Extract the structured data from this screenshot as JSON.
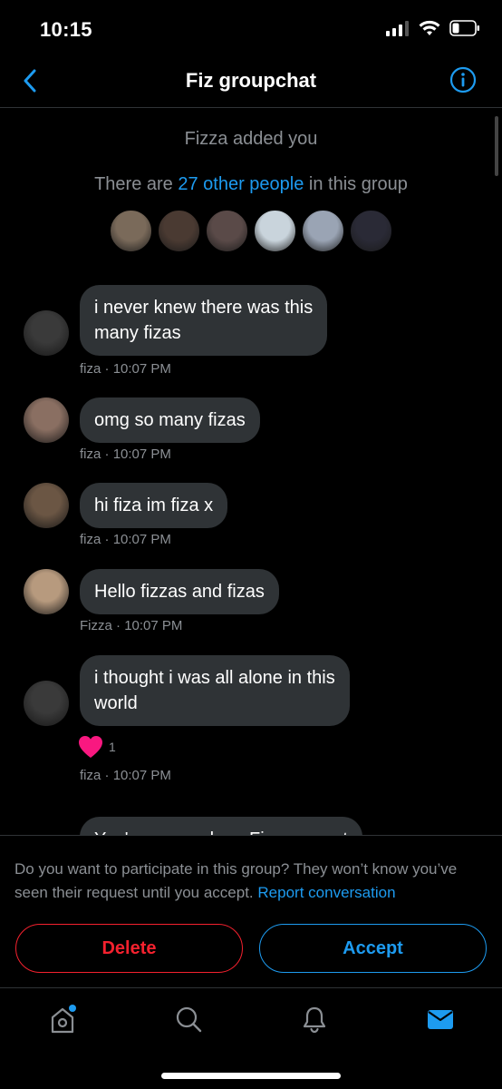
{
  "status_bar": {
    "time": "10:15"
  },
  "header": {
    "title": "Fiz groupchat"
  },
  "conversation": {
    "added_note": "Fizza added you",
    "others_prefix": "There are ",
    "others_link": "27 other people",
    "others_suffix": " in this group",
    "member_avatar_colors": [
      "#7a6a5a",
      "#4a3a32",
      "#5a4a48",
      "#c9d4dc",
      "#9aa4b4",
      "#2a2a36"
    ],
    "messages": [
      {
        "lines": [
          "i never knew there was this",
          "many fizas"
        ],
        "sender": "fiza",
        "time": "10:07 PM",
        "avatar_color": "#3a3a3a"
      },
      {
        "lines": [
          "omg so many fizas"
        ],
        "sender": "fiza",
        "time": "10:07 PM",
        "avatar_color": "#8a6f62"
      },
      {
        "lines": [
          "hi fiza im fiza x"
        ],
        "sender": "fiza",
        "time": "10:07 PM",
        "avatar_color": "#6b5644"
      },
      {
        "lines": [
          "Hello fizzas and fizas"
        ],
        "sender": "Fizza",
        "time": "10:07 PM",
        "avatar_color": "#b79a7e"
      },
      {
        "lines": [
          "i thought i was all alone in this",
          "world"
        ],
        "sender": "fiza",
        "time": "10:07 PM",
        "avatar_color": "#3a3a3a",
        "reaction": {
          "emoji": "heart",
          "count": "1"
        }
      },
      {
        "lines": [
          "You're never alone Fiza you got"
        ],
        "partial": true
      }
    ]
  },
  "request": {
    "text": "Do you want to participate in this group? They won’t know you’ve seen their request until you accept.",
    "report_link": "Report conversation",
    "delete_label": "Delete",
    "accept_label": "Accept"
  },
  "colors": {
    "accent": "#1d9bf0",
    "danger": "#f4212e",
    "bubble": "#2f3336",
    "muted": "#8b8f94"
  },
  "tabs": [
    {
      "icon": "home-icon",
      "has_dot": true
    },
    {
      "icon": "search-icon"
    },
    {
      "icon": "bell-icon"
    },
    {
      "icon": "mail-icon",
      "active": true
    }
  ]
}
